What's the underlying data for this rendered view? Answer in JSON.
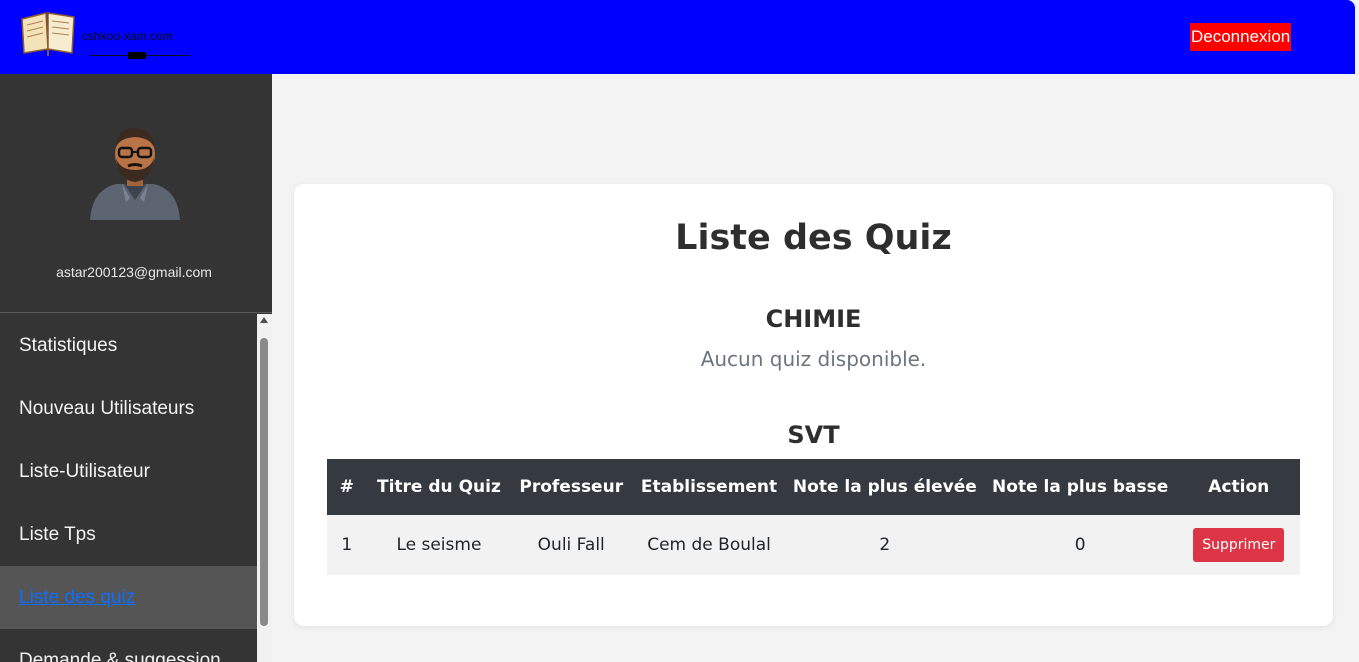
{
  "header": {
    "logo_text": "cshkou-xam.com",
    "logout_label": "Deconnexion"
  },
  "sidebar": {
    "email": "astar200123@gmail.com",
    "items": [
      {
        "label": "Statistiques"
      },
      {
        "label": "Nouveau Utilisateurs"
      },
      {
        "label": "Liste-Utilisateur"
      },
      {
        "label": "Liste Tps"
      },
      {
        "label": "Liste des quiz",
        "active": true
      },
      {
        "label": "Demande & suggession"
      }
    ]
  },
  "main": {
    "title": "Liste des Quiz",
    "sections": [
      {
        "subject": "CHIMIE",
        "empty_text": "Aucun quiz disponible."
      },
      {
        "subject": "SVT"
      }
    ],
    "table": {
      "headers": [
        "#",
        "Titre du Quiz",
        "Professeur",
        "Etablissement",
        "Note la plus élevée",
        "Note la plus basse",
        "Action"
      ],
      "rows": [
        {
          "num": "1",
          "title": "Le seisme",
          "professor": "Ouli Fall",
          "school": "Cem de Boulal",
          "max": "2",
          "min": "0",
          "action": "Supprimer"
        }
      ]
    }
  },
  "colors": {
    "topbar": "#0000fe",
    "logout": "#ff0000",
    "sidebar": "#343434",
    "active_item": "#555555",
    "link": "#0d6efd",
    "table_header": "#343a40",
    "delete": "#dc3545"
  }
}
